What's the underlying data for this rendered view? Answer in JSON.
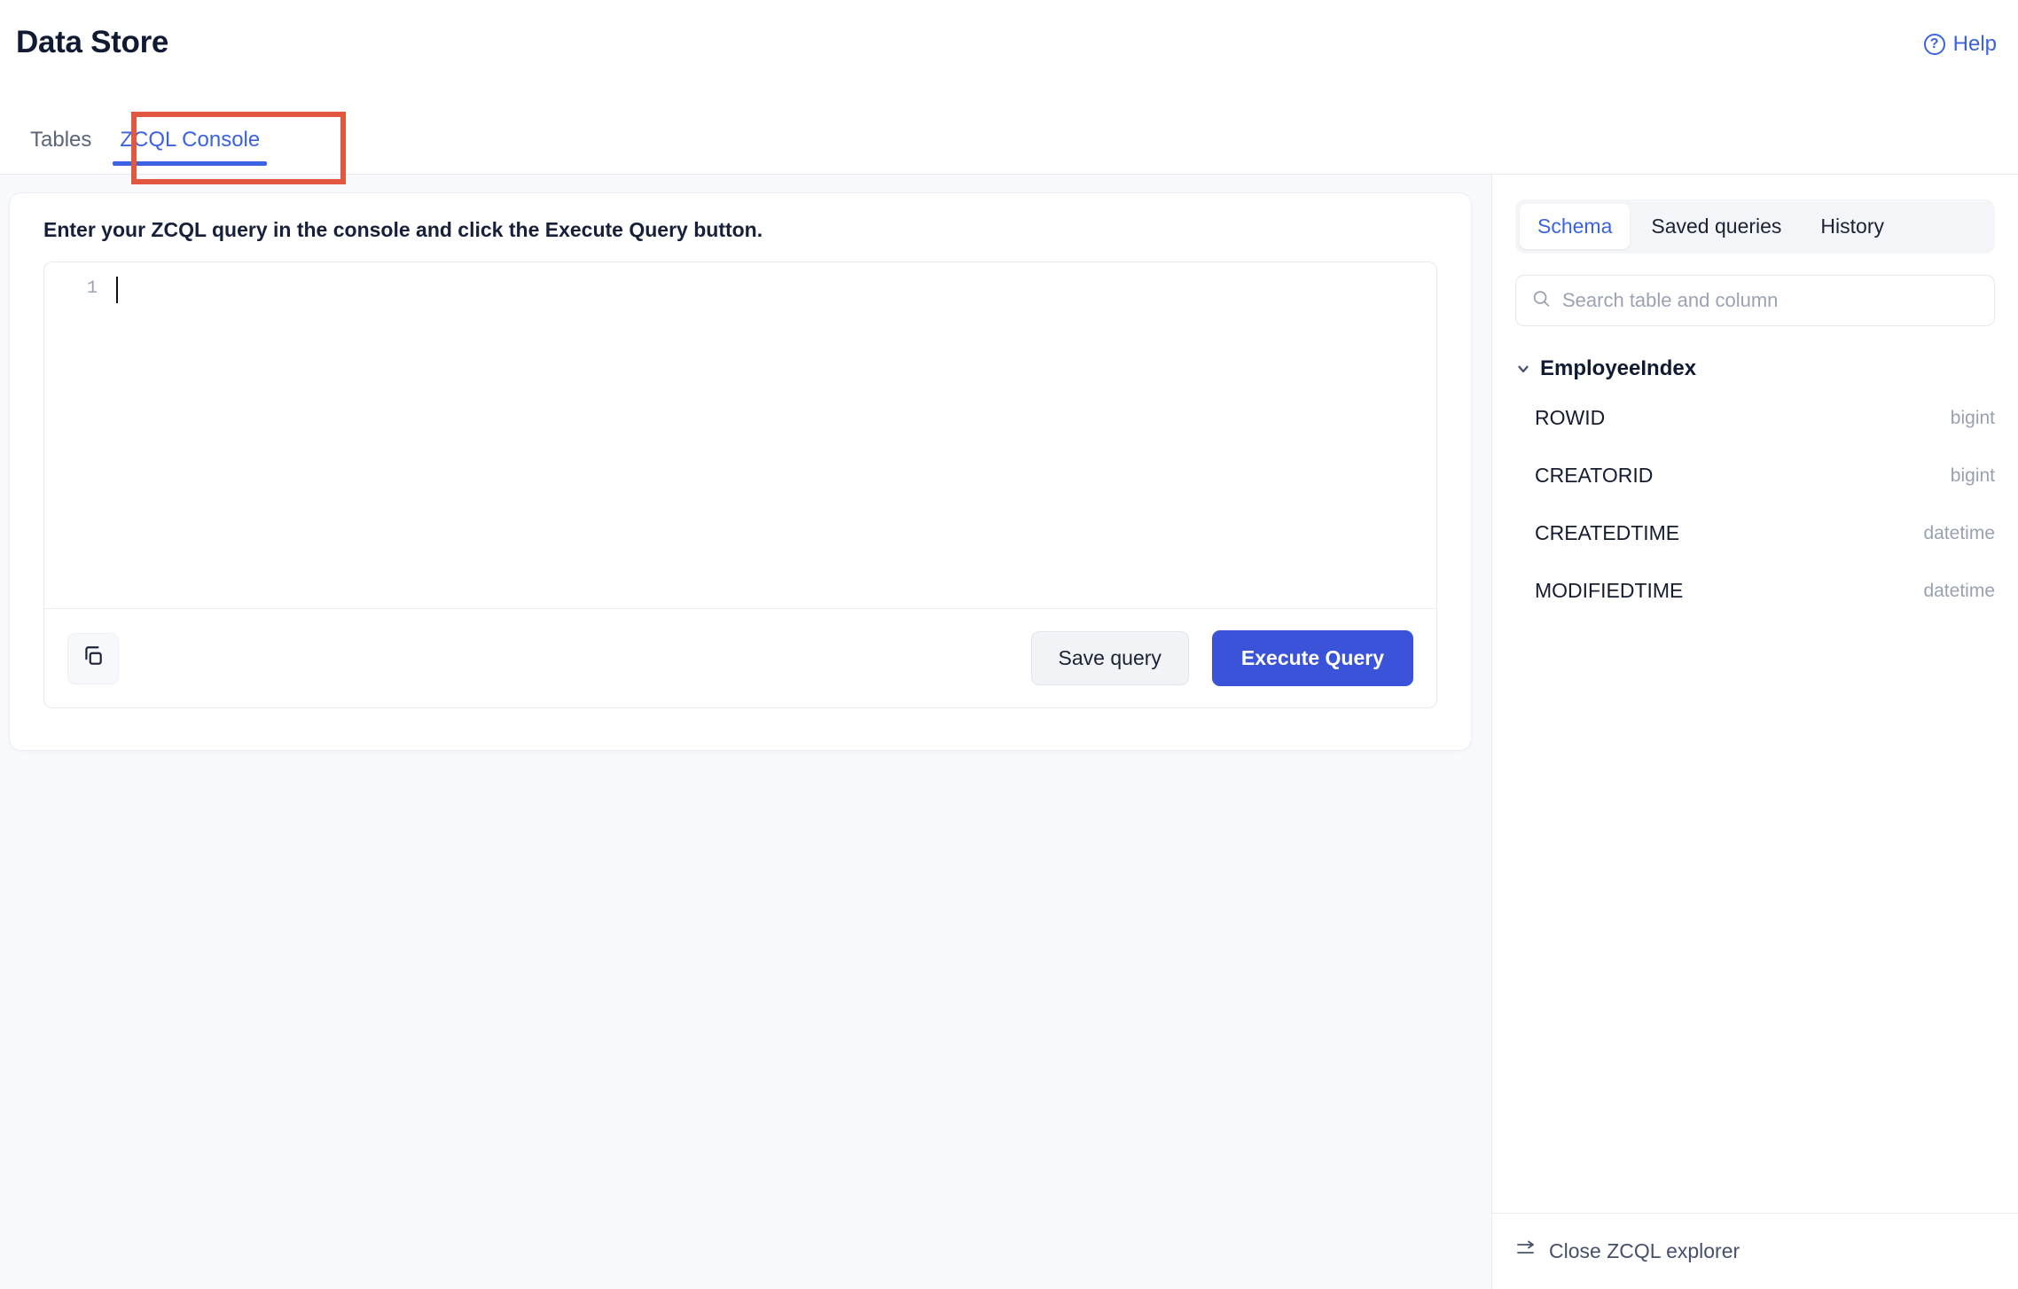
{
  "header": {
    "title": "Data Store",
    "help_label": "Help",
    "help_icon": "question-circle-icon"
  },
  "tabs": [
    {
      "label": "Tables",
      "active": false
    },
    {
      "label": "ZCQL Console",
      "active": true
    }
  ],
  "annotation": {
    "target": "ZCQL Console",
    "color": "#e2573f"
  },
  "console": {
    "hint": "Enter your ZCQL query in the console and click the Execute Query button.",
    "line_numbers": [
      "1"
    ],
    "query_text": "",
    "copy_icon": "copy-icon",
    "save_label": "Save query",
    "execute_label": "Execute Query",
    "accent_color": "#3b53d8"
  },
  "explorer": {
    "tabs": [
      {
        "label": "Schema",
        "active": true
      },
      {
        "label": "Saved queries",
        "active": false
      },
      {
        "label": "History",
        "active": false
      }
    ],
    "search": {
      "placeholder": "Search table and column",
      "value": "",
      "icon": "search-icon"
    },
    "schema": [
      {
        "table": "EmployeeIndex",
        "expanded": true,
        "columns": [
          {
            "name": "ROWID",
            "type": "bigint"
          },
          {
            "name": "CREATORID",
            "type": "bigint"
          },
          {
            "name": "CREATEDTIME",
            "type": "datetime"
          },
          {
            "name": "MODIFIEDTIME",
            "type": "datetime"
          }
        ]
      }
    ],
    "footer": {
      "close_label": "Close ZCQL explorer",
      "icon": "collapse-panel-icon"
    }
  }
}
